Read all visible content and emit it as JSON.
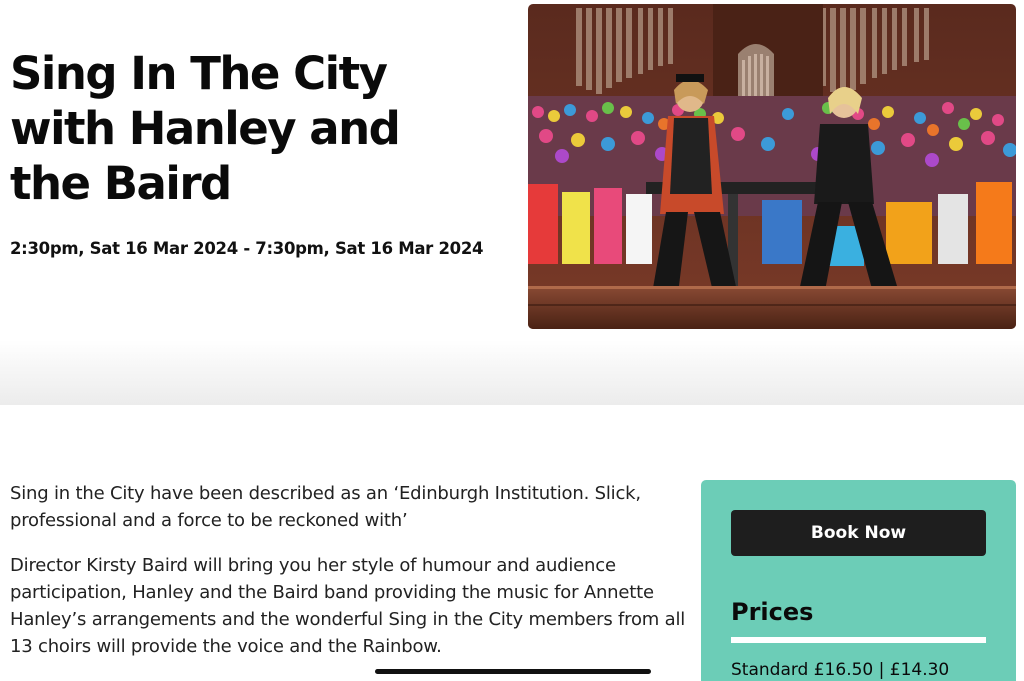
{
  "event": {
    "title_lines": [
      "Sing In The City",
      "with Hanley and",
      "the Baird"
    ],
    "datetime": "2:30pm, Sat 16 Mar 2024 - 7:30pm, Sat 16 Mar 2024"
  },
  "hero_image": {
    "alt": "Two performers on stage in front of a large choir and pipe organ"
  },
  "description": {
    "paragraphs": [
      "Sing in the City have been described as an ‘Edinburgh Institution.  Slick, professional and a force to be reckoned with’",
      "Director Kirsty Baird will bring you her style of humour and audience participation, Hanley and the Baird band providing the music for Annette Hanley’s arrangements and the wonderful Sing in the City members from all 13 choirs will provide the voice and the Rainbow."
    ]
  },
  "booking": {
    "button_label": "Book Now",
    "prices_heading": "Prices",
    "standard_price": "Standard £16.50 | £14.30"
  },
  "colors": {
    "card_background": "#6ccdb7",
    "button_background": "#1e1e1e",
    "text": "#111111"
  }
}
